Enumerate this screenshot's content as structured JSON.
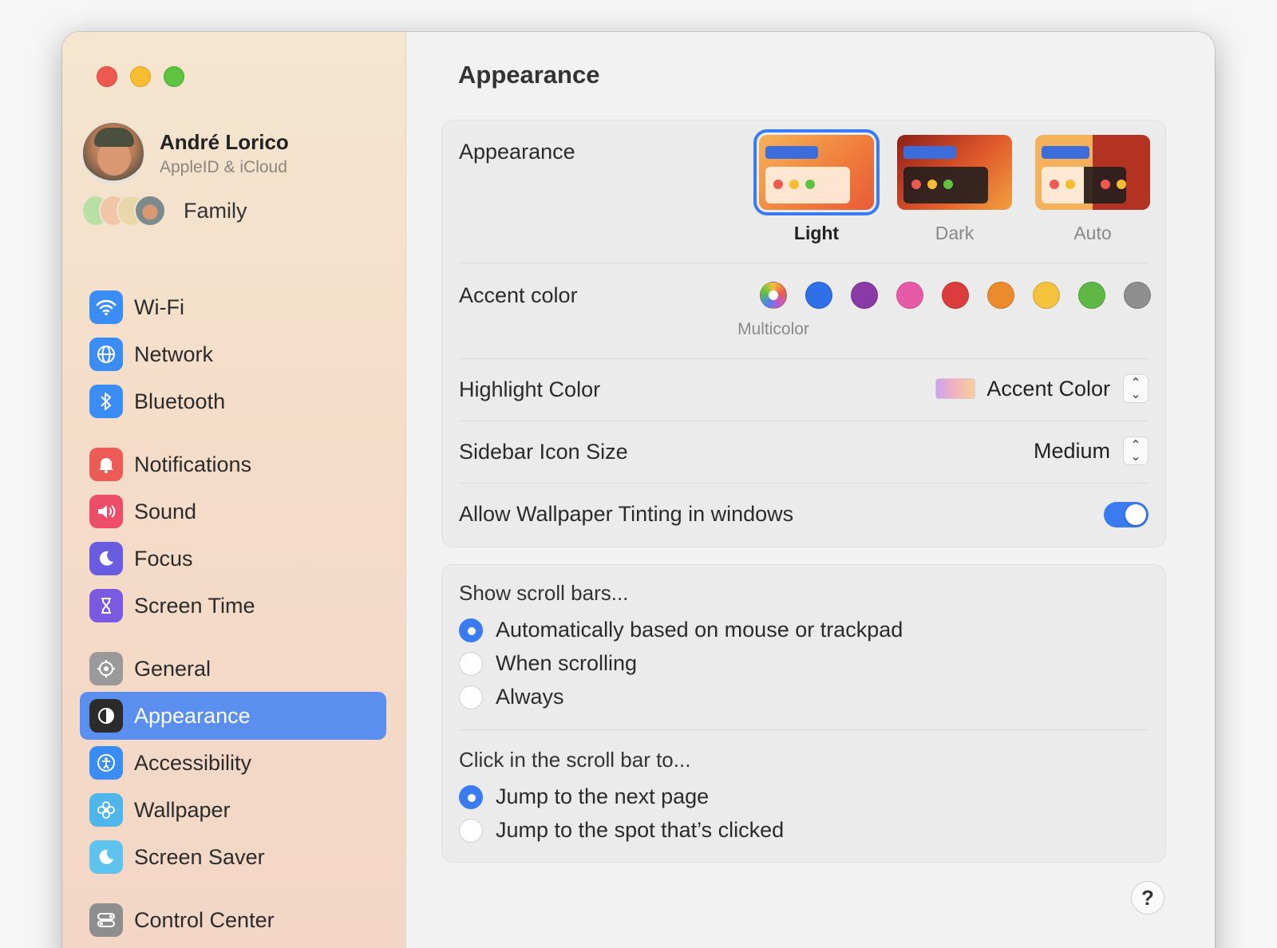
{
  "window": {
    "title": "Appearance"
  },
  "profile": {
    "name": "André Lorico",
    "subtitle": "AppleID & iCloud"
  },
  "family": {
    "label": "Family"
  },
  "sidebar": {
    "groups": [
      [
        {
          "label": "Wi-Fi",
          "icon": "wifi-icon",
          "color": "#3a8df5"
        },
        {
          "label": "Network",
          "icon": "globe-icon",
          "color": "#3a8df5"
        },
        {
          "label": "Bluetooth",
          "icon": "bluetooth-icon",
          "color": "#3a8df5"
        }
      ],
      [
        {
          "label": "Notifications",
          "icon": "bell-icon",
          "color": "#ec5b56"
        },
        {
          "label": "Sound",
          "icon": "speaker-icon",
          "color": "#ec4e6a"
        },
        {
          "label": "Focus",
          "icon": "moon-icon",
          "color": "#6a5ce0"
        },
        {
          "label": "Screen Time",
          "icon": "hourglass-icon",
          "color": "#7a5ae0"
        }
      ],
      [
        {
          "label": "General",
          "icon": "gear-icon",
          "color": "#9a9a9a"
        },
        {
          "label": "Appearance",
          "icon": "appearance-icon",
          "color": "#2b2b2b",
          "active": true
        },
        {
          "label": "Accessibility",
          "icon": "accessibility-icon",
          "color": "#3a8df5"
        },
        {
          "label": "Wallpaper",
          "icon": "flower-icon",
          "color": "#4fb6ec"
        },
        {
          "label": "Screen Saver",
          "icon": "screensaver-icon",
          "color": "#5fc3ef"
        }
      ],
      [
        {
          "label": "Control Center",
          "icon": "switches-icon",
          "color": "#8e8e8e"
        }
      ]
    ]
  },
  "appearance": {
    "label": "Appearance",
    "options": [
      {
        "label": "Light",
        "selected": true
      },
      {
        "label": "Dark",
        "selected": false
      },
      {
        "label": "Auto",
        "selected": false
      }
    ]
  },
  "accent": {
    "label": "Accent color",
    "caption": "Multicolor",
    "colors": [
      "multicolor",
      "#2f6fe8",
      "#8a3aa6",
      "#e65aa6",
      "#db3d3d",
      "#ec8a2e",
      "#f4c33c",
      "#5fb745",
      "#8e8e8e"
    ]
  },
  "highlight": {
    "label": "Highlight Color",
    "value": "Accent Color"
  },
  "icon_size": {
    "label": "Sidebar Icon Size",
    "value": "Medium"
  },
  "tinting": {
    "label": "Allow Wallpaper Tinting in windows",
    "on": true
  },
  "scrollbars": {
    "title": "Show scroll bars...",
    "options": [
      {
        "label": "Automatically based on mouse or trackpad",
        "selected": true
      },
      {
        "label": "When scrolling",
        "selected": false
      },
      {
        "label": "Always",
        "selected": false
      }
    ]
  },
  "click_scroll": {
    "title": "Click in the scroll bar to...",
    "options": [
      {
        "label": "Jump to the next page",
        "selected": true
      },
      {
        "label": "Jump to the spot that’s clicked",
        "selected": false
      }
    ]
  },
  "help": {
    "label": "?"
  }
}
